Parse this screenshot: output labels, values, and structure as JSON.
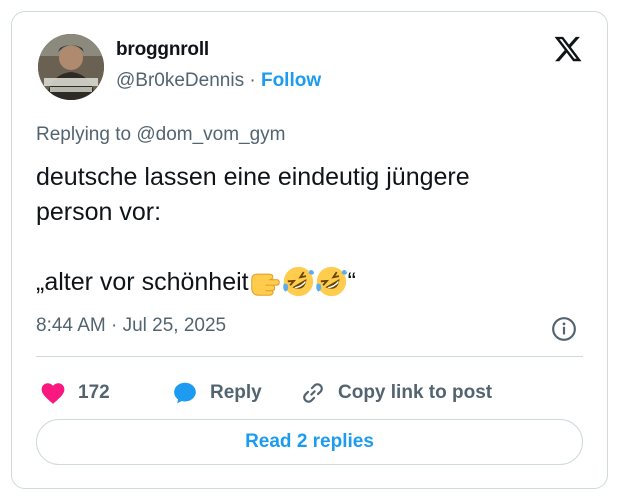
{
  "author": {
    "display_name": "broggnroll",
    "handle": "@Br0keDennis",
    "separator": "·",
    "follow_label": "Follow"
  },
  "logo": {
    "icon": "x-logo-icon"
  },
  "tweet": {
    "replying_to": "Replying to @dom_vom_gym",
    "line1": "deutsche lassen eine eindeutig jüngere",
    "line2": "person vor:",
    "quote_open": "„alter vor schönheit",
    "quote_close": "“",
    "emojis": [
      "backhand-index-pointing-right-emoji",
      "rolling-on-the-floor-laughing-emoji",
      "rolling-on-the-floor-laughing-emoji"
    ],
    "timestamp": "8:44 AM · Jul 25, 2025"
  },
  "actions": {
    "like_count": "172",
    "reply_label": "Reply",
    "copy_label": "Copy link to post"
  },
  "read_replies_label": "Read 2 replies",
  "colors": {
    "accent": "#1d9bf0",
    "like": "#f91880",
    "text_secondary": "#536471",
    "border": "#cfd9de"
  }
}
